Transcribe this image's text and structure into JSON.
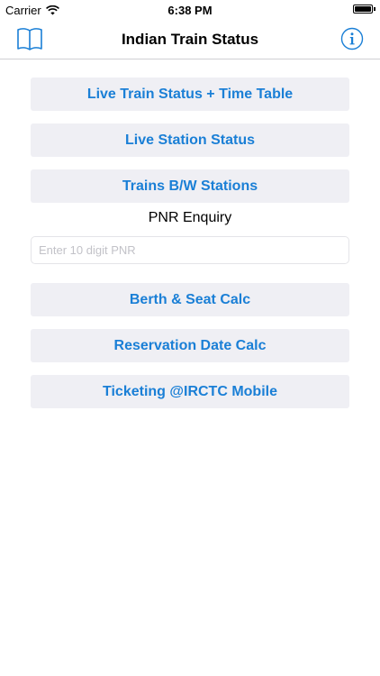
{
  "status_bar": {
    "carrier": "Carrier",
    "time": "6:38 PM",
    "wifi_icon": "wifi-icon",
    "battery_icon": "battery-icon"
  },
  "nav": {
    "title": "Indian Train Status",
    "left_icon": "book-icon",
    "right_icon": "info-icon"
  },
  "menu": {
    "live_train_status": "Live Train Status + Time Table",
    "live_station_status": "Live Station Status",
    "trains_between_stations": "Trains B/W Stations",
    "berth_seat_calc": "Berth & Seat Calc",
    "reservation_date_calc": "Reservation Date Calc",
    "ticketing_irctc": "Ticketing @IRCTC Mobile"
  },
  "pnr": {
    "label": "PNR Enquiry",
    "value": "",
    "placeholder": "Enter 10 digit PNR"
  },
  "colors": {
    "accent": "#1a7fd6",
    "button_bg": "#efeff4",
    "separator": "#d0d0d4",
    "placeholder": "#c2c2c8"
  }
}
